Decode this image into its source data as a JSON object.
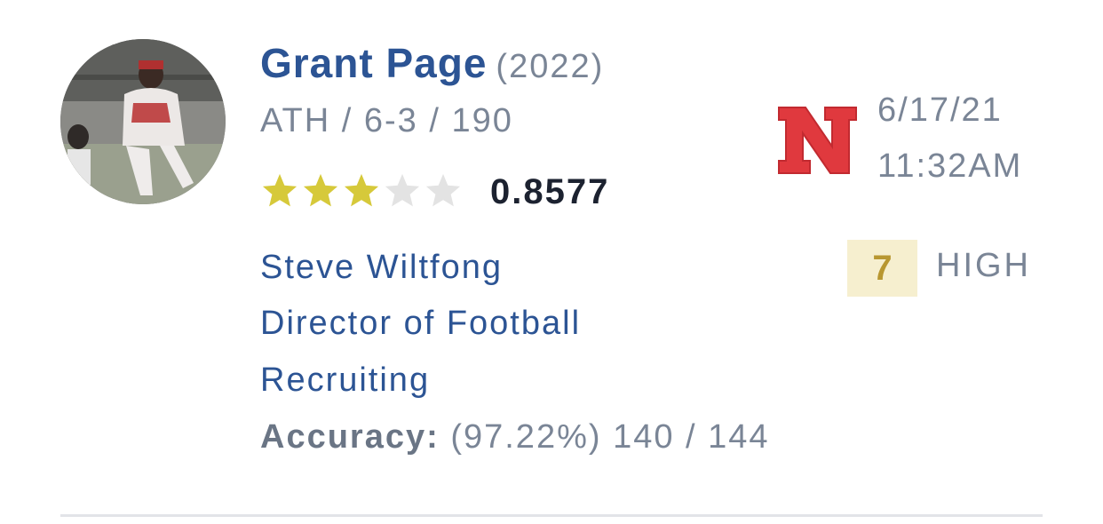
{
  "prediction": {
    "player": {
      "name": "Grant Page",
      "year": "(2022)",
      "meta": "ATH / 6-3 / 190",
      "stars_filled": 3,
      "stars_total": 5,
      "rating": "0.8577"
    },
    "school": {
      "logo_letter": "N",
      "logo_color": "#e0393e"
    },
    "timestamp": {
      "date": "6/17/21",
      "time": "11:32AM"
    },
    "confidence": {
      "value": "7",
      "level": "HIGH"
    },
    "scout": {
      "name": "Steve Wiltfong",
      "title_line1": "Director of Football",
      "title_line2": "Recruiting"
    },
    "accuracy": {
      "label": "Accuracy:",
      "value": "(97.22%) 140 / 144"
    }
  },
  "colors": {
    "primary_blue": "#2c5494",
    "muted_gray": "#7a8596",
    "star_gold": "#d6c93a",
    "star_empty": "#e3e3e3",
    "confidence_bg": "#f6efcf",
    "confidence_text": "#b89731"
  },
  "icons": {
    "star": "star-icon",
    "school": "nebraska-n-logo"
  }
}
